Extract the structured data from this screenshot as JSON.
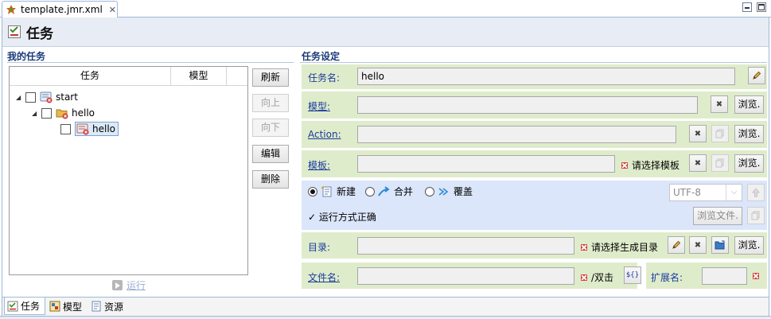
{
  "editor": {
    "tab_label": "template.jmr.xml",
    "close_glyph": "✕",
    "page_title": "任务"
  },
  "left": {
    "section_title": "我的任务",
    "columns": [
      "任务",
      "模型"
    ],
    "tree": [
      {
        "label": "start",
        "level": 0,
        "expanded": true,
        "icon": "task-folder-icon"
      },
      {
        "label": "hello",
        "level": 1,
        "expanded": true,
        "icon": "folder-icon"
      },
      {
        "label": "hello",
        "level": 2,
        "selected": true,
        "icon": "task-item-icon"
      }
    ],
    "buttons": {
      "refresh": "刷新",
      "up": "向上",
      "down": "向下",
      "edit": "编辑",
      "delete": "删除"
    },
    "run": "运行"
  },
  "right": {
    "section_title": "任务设定",
    "task_name_label": "任务名:",
    "task_name_value": "hello",
    "model_label": "模型:",
    "action_label": "Action:",
    "template_label": "模板:",
    "template_hint": "请选择模板",
    "browse": "浏览.",
    "mode": {
      "new": "新建",
      "merge": "合并",
      "overwrite": "覆盖",
      "selected": "new"
    },
    "encoding": "UTF-8",
    "run_ok": "✓ 运行方式正确",
    "browse_file": "浏览文件.",
    "dir_label": "目录:",
    "dir_hint": "请选择生成目录",
    "filename_label": "文件名:",
    "filename_hint": "/双击",
    "var_button": "${}",
    "ext_label": "扩展名:"
  },
  "bottom_tabs": [
    {
      "label": "任务",
      "icon": "task-icon",
      "active": true
    },
    {
      "label": "模型",
      "icon": "model-icon",
      "active": false
    },
    {
      "label": "资源",
      "icon": "resource-icon",
      "active": false
    }
  ],
  "colors": {
    "green_row": "#dfeccb",
    "blue_row": "#dbe6fb",
    "section_title": "#1a3a78",
    "link": "#1a3a9e"
  }
}
